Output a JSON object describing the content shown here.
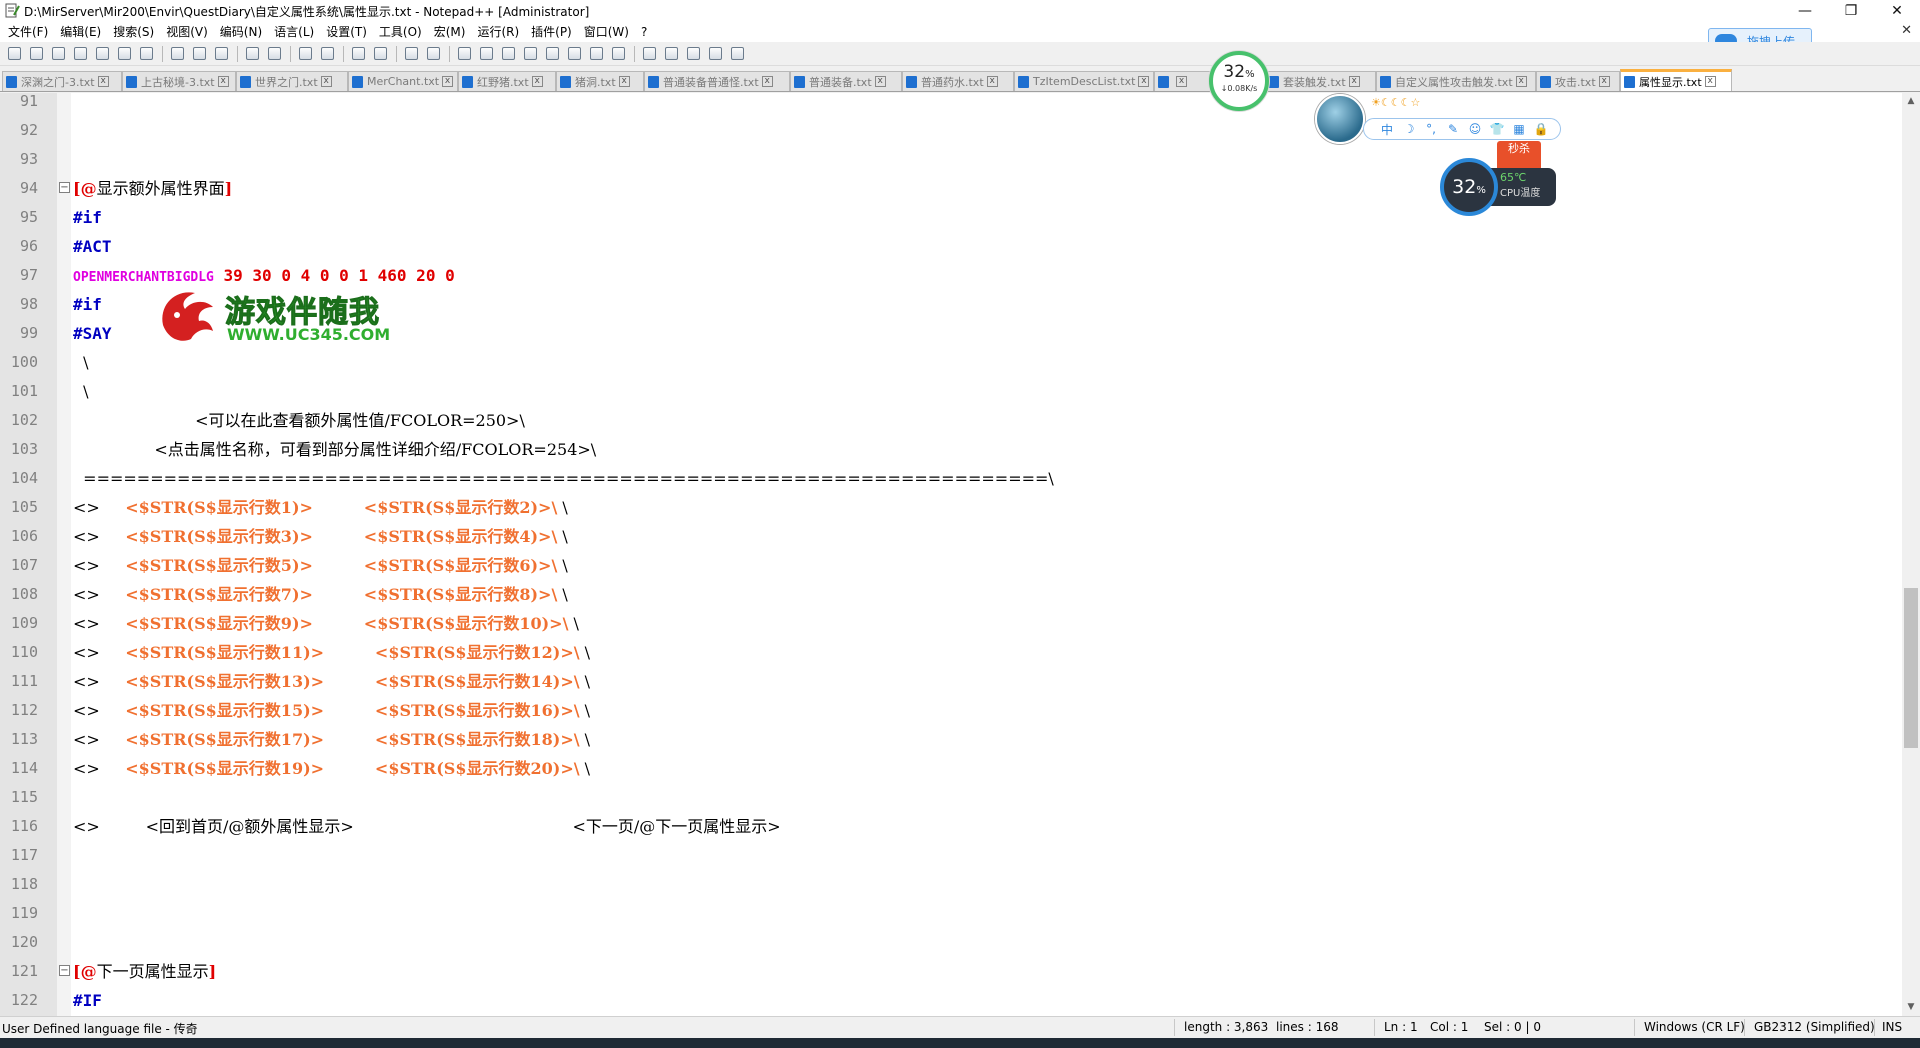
{
  "window": {
    "title": "D:\\MirServer\\Mir200\\Envir\\QuestDiary\\自定义属性系统\\属性显示.txt - Notepad++ [Administrator]",
    "minimize": "—",
    "maximize": "❐",
    "close": "✕"
  },
  "menu": {
    "items": [
      "文件(F)",
      "编辑(E)",
      "搜索(S)",
      "视图(V)",
      "编码(N)",
      "语言(L)",
      "设置(T)",
      "工具(O)",
      "宏(M)",
      "运行(R)",
      "插件(P)",
      "窗口(W)",
      "?"
    ],
    "close_doc": "✕"
  },
  "upload_button": {
    "label": "拖拽上传"
  },
  "tabs": [
    {
      "label": "深渊之门-3.txt",
      "active": false
    },
    {
      "label": "上古秘境-3.txt",
      "active": false
    },
    {
      "label": "世界之门.txt",
      "active": false
    },
    {
      "label": "MerChant.txt",
      "active": false
    },
    {
      "label": "红野猪.txt",
      "active": false
    },
    {
      "label": "猪洞.txt",
      "active": false
    },
    {
      "label": "普通装备普通怪.txt",
      "active": false
    },
    {
      "label": "普通装备.txt",
      "active": false
    },
    {
      "label": "普通药水.txt",
      "active": false
    },
    {
      "label": "TzItemDescList.txt",
      "active": false
    },
    {
      "label": "",
      "active": false
    },
    {
      "label": "套装触发.txt",
      "active": false
    },
    {
      "label": "自定义属性攻击触发.txt",
      "active": false
    },
    {
      "label": "攻击.txt",
      "active": false
    },
    {
      "label": "属性显示.txt",
      "active": true
    }
  ],
  "editor": {
    "lines": [
      {
        "n": "91",
        "segs": []
      },
      {
        "n": "92",
        "segs": []
      },
      {
        "n": "93",
        "segs": []
      },
      {
        "n": "94",
        "fold": "−",
        "segs": [
          {
            "c": "c-label",
            "t": "[@"
          },
          {
            "c": "c-plain",
            "t": "显示额外属性界面"
          },
          {
            "c": "c-label",
            "t": "]"
          }
        ]
      },
      {
        "n": "95",
        "segs": [
          {
            "c": "c-kw",
            "t": "#if"
          }
        ]
      },
      {
        "n": "96",
        "segs": [
          {
            "c": "c-kw",
            "t": "#ACT"
          }
        ]
      },
      {
        "n": "97",
        "segs": [
          {
            "c": "c-magenta",
            "t": "OPENMERCHANTBIGDLG"
          },
          {
            "c": "c-num",
            "t": " 39 30 0 4 0 0 1 460 20 0"
          }
        ]
      },
      {
        "n": "98",
        "segs": [
          {
            "c": "c-kw",
            "t": "#if"
          }
        ]
      },
      {
        "n": "99",
        "segs": [
          {
            "c": "c-kw",
            "t": "#SAY"
          }
        ]
      },
      {
        "n": "100",
        "segs": [
          {
            "c": "c-plain",
            "t": "  \\"
          }
        ]
      },
      {
        "n": "101",
        "segs": [
          {
            "c": "c-plain",
            "t": "  \\"
          }
        ]
      },
      {
        "n": "102",
        "segs": [
          {
            "c": "c-plain",
            "t": "                        <可以在此查看额外属性值/FCOLOR=250>\\"
          }
        ]
      },
      {
        "n": "103",
        "segs": [
          {
            "c": "c-plain",
            "t": "                <点击属性名称，可看到部分属性详细介绍/FCOLOR=254>\\"
          }
        ]
      },
      {
        "n": "104",
        "segs": [
          {
            "c": "c-plain",
            "t": "  ========================================================================\\"
          }
        ]
      },
      {
        "n": "105",
        "segs": [
          {
            "c": "c-plain",
            "t": "<>     "
          },
          {
            "c": "c-orange",
            "t": "<$STR(S$显示行数1)>"
          },
          {
            "c": "c-plain",
            "t": "          "
          },
          {
            "c": "c-orange",
            "t": "<$STR(S$显示行数2)>\\"
          },
          {
            "c": "c-plain",
            "t": " \\"
          }
        ]
      },
      {
        "n": "106",
        "segs": [
          {
            "c": "c-plain",
            "t": "<>     "
          },
          {
            "c": "c-orange",
            "t": "<$STR(S$显示行数3)>"
          },
          {
            "c": "c-plain",
            "t": "          "
          },
          {
            "c": "c-orange",
            "t": "<$STR(S$显示行数4)>\\"
          },
          {
            "c": "c-plain",
            "t": " \\"
          }
        ]
      },
      {
        "n": "107",
        "segs": [
          {
            "c": "c-plain",
            "t": "<>     "
          },
          {
            "c": "c-orange",
            "t": "<$STR(S$显示行数5)>"
          },
          {
            "c": "c-plain",
            "t": "          "
          },
          {
            "c": "c-orange",
            "t": "<$STR(S$显示行数6)>\\"
          },
          {
            "c": "c-plain",
            "t": " \\"
          }
        ]
      },
      {
        "n": "108",
        "segs": [
          {
            "c": "c-plain",
            "t": "<>     "
          },
          {
            "c": "c-orange",
            "t": "<$STR(S$显示行数7)>"
          },
          {
            "c": "c-plain",
            "t": "          "
          },
          {
            "c": "c-orange",
            "t": "<$STR(S$显示行数8)>\\"
          },
          {
            "c": "c-plain",
            "t": " \\"
          }
        ]
      },
      {
        "n": "109",
        "segs": [
          {
            "c": "c-plain",
            "t": "<>     "
          },
          {
            "c": "c-orange",
            "t": "<$STR(S$显示行数9)>"
          },
          {
            "c": "c-plain",
            "t": "          "
          },
          {
            "c": "c-orange",
            "t": "<$STR(S$显示行数10)>\\"
          },
          {
            "c": "c-plain",
            "t": " \\"
          }
        ]
      },
      {
        "n": "110",
        "segs": [
          {
            "c": "c-plain",
            "t": "<>     "
          },
          {
            "c": "c-orange",
            "t": "<$STR(S$显示行数11)>"
          },
          {
            "c": "c-plain",
            "t": "          "
          },
          {
            "c": "c-orange",
            "t": "<$STR(S$显示行数12)>\\"
          },
          {
            "c": "c-plain",
            "t": " \\"
          }
        ]
      },
      {
        "n": "111",
        "segs": [
          {
            "c": "c-plain",
            "t": "<>     "
          },
          {
            "c": "c-orange",
            "t": "<$STR(S$显示行数13)>"
          },
          {
            "c": "c-plain",
            "t": "          "
          },
          {
            "c": "c-orange",
            "t": "<$STR(S$显示行数14)>\\"
          },
          {
            "c": "c-plain",
            "t": " \\"
          }
        ]
      },
      {
        "n": "112",
        "segs": [
          {
            "c": "c-plain",
            "t": "<>     "
          },
          {
            "c": "c-orange",
            "t": "<$STR(S$显示行数15)>"
          },
          {
            "c": "c-plain",
            "t": "          "
          },
          {
            "c": "c-orange",
            "t": "<$STR(S$显示行数16)>\\"
          },
          {
            "c": "c-plain",
            "t": " \\"
          }
        ]
      },
      {
        "n": "113",
        "segs": [
          {
            "c": "c-plain",
            "t": "<>     "
          },
          {
            "c": "c-orange",
            "t": "<$STR(S$显示行数17)>"
          },
          {
            "c": "c-plain",
            "t": "          "
          },
          {
            "c": "c-orange",
            "t": "<$STR(S$显示行数18)>\\"
          },
          {
            "c": "c-plain",
            "t": " \\"
          }
        ]
      },
      {
        "n": "114",
        "segs": [
          {
            "c": "c-plain",
            "t": "<>     "
          },
          {
            "c": "c-orange",
            "t": "<$STR(S$显示行数19)>"
          },
          {
            "c": "c-plain",
            "t": "          "
          },
          {
            "c": "c-orange",
            "t": "<$STR(S$显示行数20)>\\"
          },
          {
            "c": "c-plain",
            "t": " \\"
          }
        ]
      },
      {
        "n": "115",
        "segs": []
      },
      {
        "n": "116",
        "segs": [
          {
            "c": "c-plain",
            "t": "<>         <回到首页/@额外属性显示>                                           <下一页/@下一页属性显示>"
          }
        ]
      },
      {
        "n": "117",
        "segs": []
      },
      {
        "n": "118",
        "segs": []
      },
      {
        "n": "119",
        "segs": []
      },
      {
        "n": "120",
        "segs": []
      },
      {
        "n": "121",
        "fold": "−",
        "segs": [
          {
            "c": "c-label",
            "t": "[@"
          },
          {
            "c": "c-plain",
            "t": "下一页属性显示"
          },
          {
            "c": "c-label",
            "t": "]"
          }
        ]
      },
      {
        "n": "122",
        "segs": [
          {
            "c": "c-kw",
            "t": "#IF"
          }
        ]
      }
    ]
  },
  "status": {
    "language": "User Defined language file - 传奇",
    "length": "length : 3,863",
    "lines": "lines : 168",
    "ln": "Ln : 1",
    "col": "Col : 1",
    "sel": "Sel : 0 | 0",
    "eol": "Windows (CR LF)",
    "encoding": "GB2312 (Simplified)",
    "mode": "INS"
  },
  "overlays": {
    "net": {
      "pct": "32",
      "unit": "%",
      "speed": "↓0.08K/s"
    },
    "cpu": {
      "pct": "32",
      "unit": "%",
      "temp": "65℃",
      "label": "CPU温度"
    },
    "promo": "秒杀",
    "ime_stars": "☀☾☾☾☆",
    "ime_tools": [
      "中",
      "☽",
      "°,",
      "✎",
      "☺",
      "👕",
      "▦",
      "🔒"
    ],
    "watermark": {
      "title": "游戏伴随我",
      "url": "WWW.UC345.COM"
    }
  },
  "colors": {
    "label": "#e00000",
    "keyword": "#0000c0",
    "command": "#e000e0",
    "string_var": "#f07030",
    "active_tab_accent": "#fab040"
  }
}
